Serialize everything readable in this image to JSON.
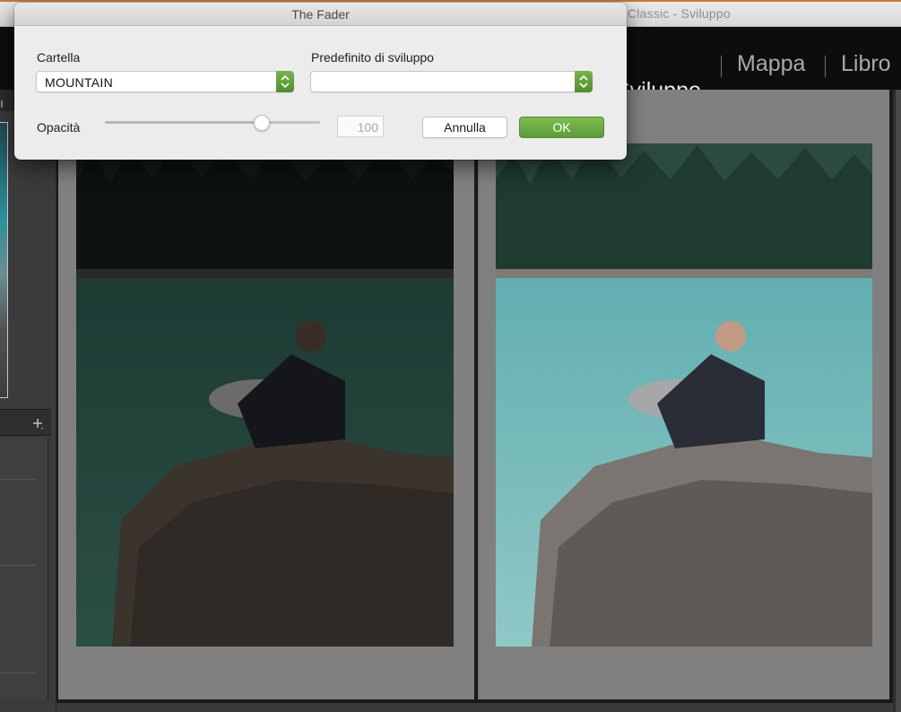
{
  "app": {
    "window_title": "Classic - Sviluppo",
    "modules": [
      {
        "label": "Sviluppo",
        "active": true
      },
      {
        "label": "Mappa",
        "active": false
      },
      {
        "label": "Libro",
        "active": false
      }
    ]
  },
  "dialog": {
    "title": "The Fader",
    "folder_label": "Cartella",
    "folder_value": "MOUNTAIN",
    "preset_label": "Predefinito di sviluppo",
    "preset_value": "",
    "opacity_label": "Opacità",
    "opacity_value": "100",
    "opacity_slider_level": 0.73,
    "cancel_label": "Annulla",
    "ok_label": "OK",
    "accent_color": "#5b9c36"
  },
  "compare": {
    "before_tone": "dark",
    "after_tone": "bright"
  },
  "icons": {
    "plus": "plus-icon",
    "stepper": "up-down-stepper-icon"
  }
}
